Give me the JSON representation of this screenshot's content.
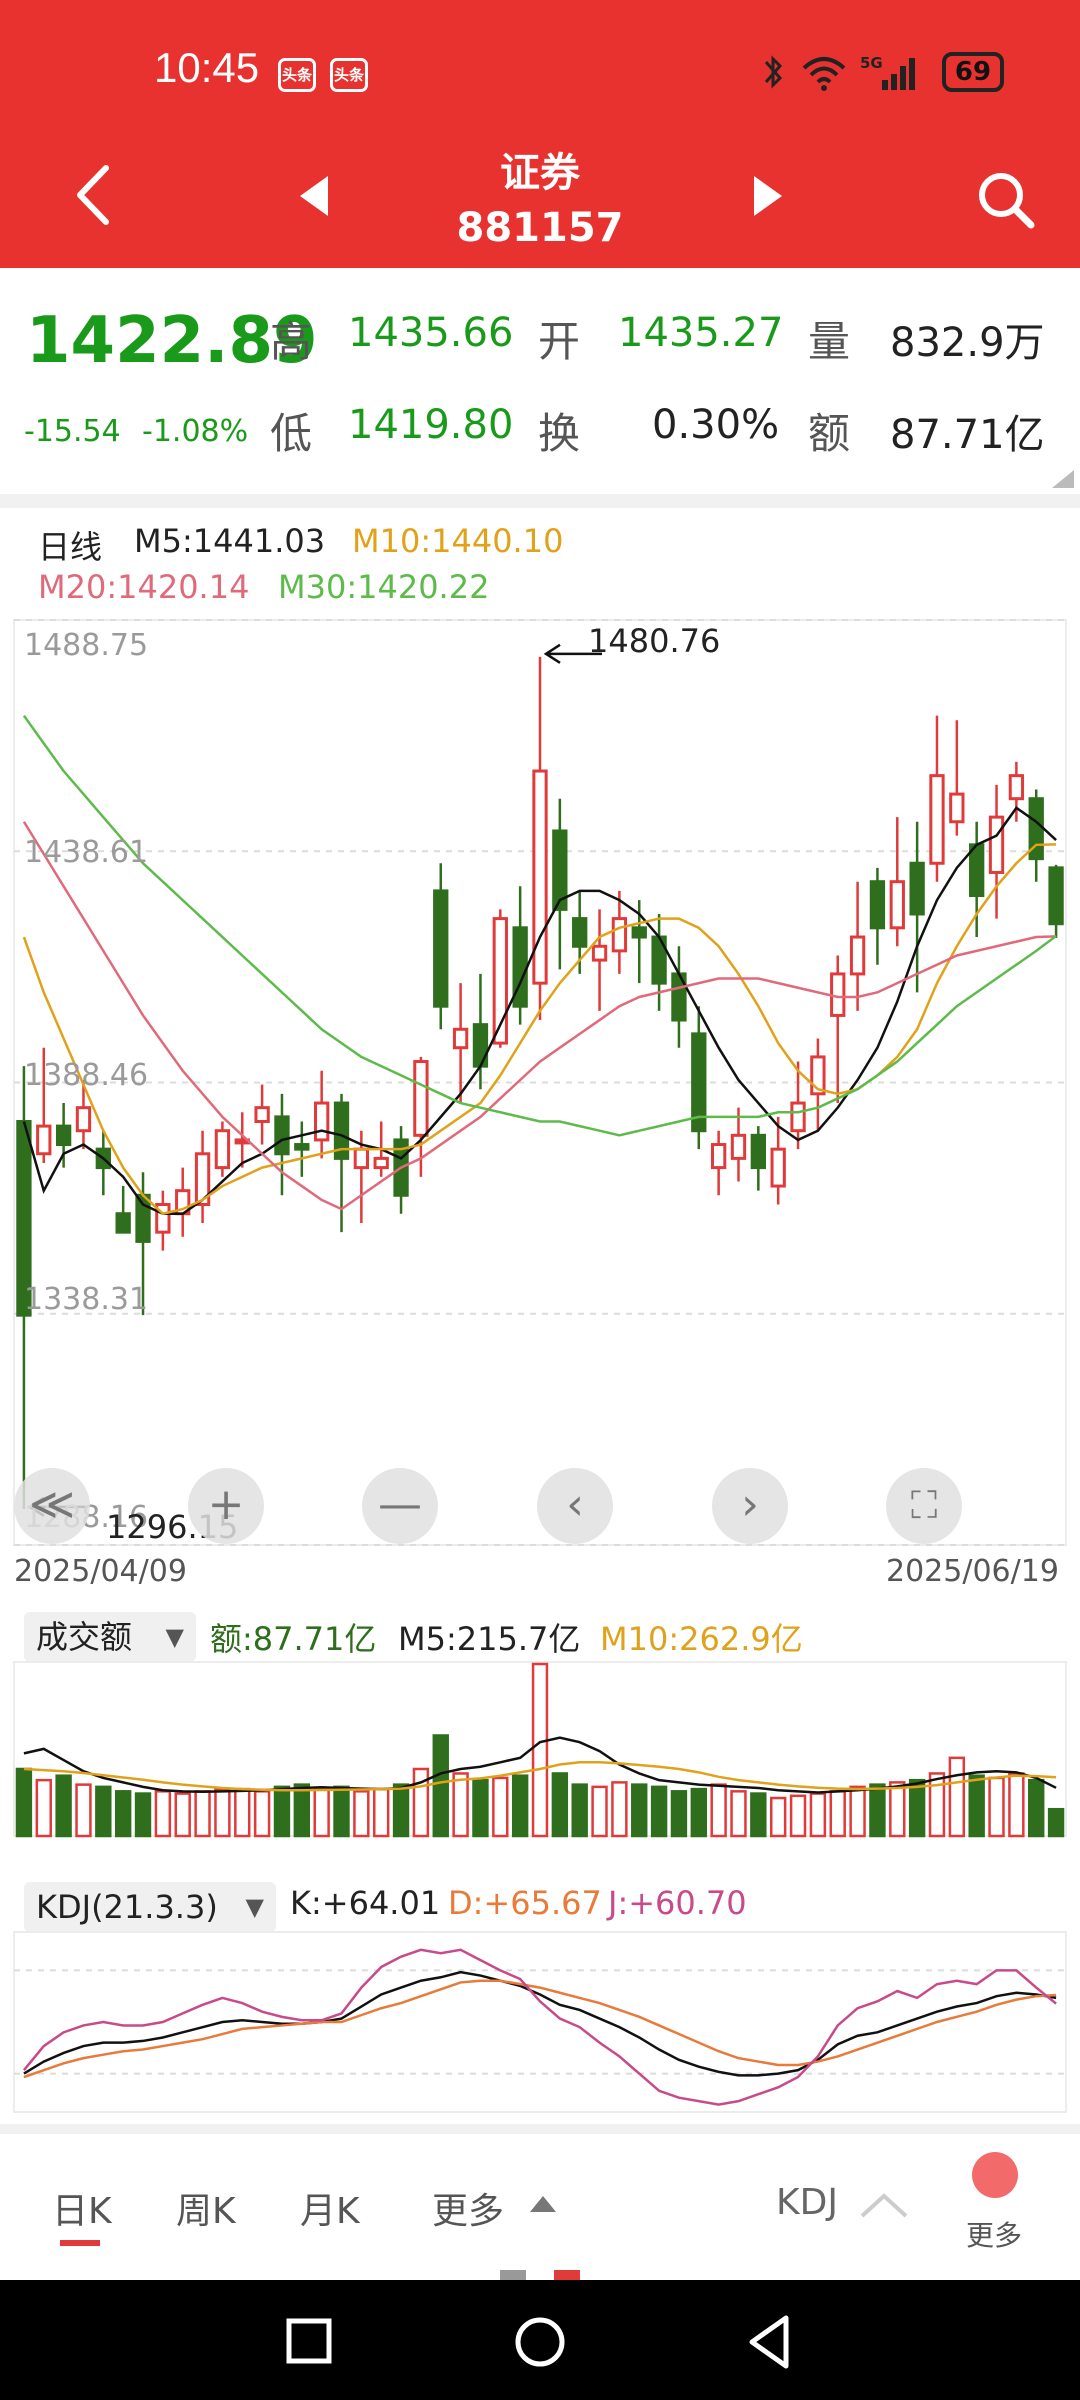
{
  "status_bar": {
    "time": "10:45",
    "app_icons": [
      "头条",
      "头条"
    ],
    "battery": "69"
  },
  "header": {
    "title": "证券",
    "code": "881157"
  },
  "quote": {
    "price": "1422.89",
    "change": "-15.54",
    "change_pct": "-1.08%",
    "high_label": "高",
    "high": "1435.66",
    "open_label": "开",
    "open": "1435.27",
    "volume_label": "量",
    "volume": "832.9万",
    "low_label": "低",
    "low": "1419.80",
    "turnover_label": "换",
    "turnover": "0.30%",
    "amount_label": "额",
    "amount": "87.71亿"
  },
  "ma_legend": {
    "period": "日线",
    "m5": "M5:1441.03",
    "m10": "M10:1440.10",
    "m20": "M20:1420.14",
    "m30": "M30:1420.22"
  },
  "colors": {
    "header_red": "#e8322f",
    "up": "#e03a3a",
    "down": "#2e6e1c",
    "m5": "#111111",
    "m10": "#e0a21a",
    "m20": "#e06a7a",
    "m30": "#5dbb4a",
    "kdj_d": "#e87a3a",
    "kdj_j": "#c84a8a"
  },
  "chart_data": [
    {
      "type": "candlestick",
      "title": "",
      "y_tick_labels": [
        "1488.75",
        "1438.61",
        "1388.46",
        "1338.31",
        "1288.16"
      ],
      "ylim": [
        1288.16,
        1488.75
      ],
      "max_annotation": "1480.76",
      "min_annotation": "1296.15",
      "date_start": "2025/04/09",
      "date_end": "2025/06/19",
      "candles": [
        [
          1380,
          1338,
          1392,
          1296
        ],
        [
          1373,
          1379,
          1396,
          1371
        ],
        [
          1379,
          1375,
          1384,
          1370
        ],
        [
          1378,
          1383,
          1389,
          1374
        ],
        [
          1374,
          1370,
          1378,
          1364
        ],
        [
          1360,
          1356,
          1366,
          1356
        ],
        [
          1364,
          1354,
          1369,
          1338
        ],
        [
          1356,
          1362,
          1365,
          1352
        ],
        [
          1360,
          1365,
          1370,
          1355
        ],
        [
          1362,
          1373,
          1378,
          1358
        ],
        [
          1370,
          1378,
          1380,
          1368
        ],
        [
          1376,
          1376,
          1382,
          1370
        ],
        [
          1380,
          1383,
          1388,
          1375
        ],
        [
          1381,
          1373,
          1386,
          1364
        ],
        [
          1375,
          1374,
          1380,
          1368
        ],
        [
          1376,
          1384,
          1391,
          1372
        ],
        [
          1384,
          1372,
          1386,
          1356
        ],
        [
          1370,
          1374,
          1378,
          1358
        ],
        [
          1370,
          1372,
          1380,
          1368
        ],
        [
          1376,
          1364,
          1379,
          1360
        ],
        [
          1377,
          1393,
          1394,
          1368
        ],
        [
          1430,
          1405,
          1436,
          1400
        ],
        [
          1396,
          1400,
          1410,
          1384
        ],
        [
          1401,
          1392,
          1412,
          1387
        ],
        [
          1397,
          1424,
          1426,
          1396
        ],
        [
          1422,
          1405,
          1431,
          1401
        ],
        [
          1410,
          1456,
          1480.76,
          1402
        ],
        [
          1443,
          1426,
          1450,
          1413
        ],
        [
          1424,
          1418,
          1430,
          1412
        ],
        [
          1415,
          1418,
          1426,
          1404
        ],
        [
          1417,
          1424,
          1430,
          1412
        ],
        [
          1422,
          1420,
          1428,
          1410
        ],
        [
          1420,
          1410,
          1425,
          1404
        ],
        [
          1412,
          1402,
          1418,
          1396
        ],
        [
          1399,
          1378,
          1405,
          1374
        ],
        [
          1370,
          1375,
          1378,
          1364
        ],
        [
          1372,
          1377,
          1383,
          1367
        ],
        [
          1377,
          1370,
          1379,
          1365
        ],
        [
          1366,
          1374,
          1381,
          1362
        ],
        [
          1378,
          1384,
          1393,
          1374
        ],
        [
          1386,
          1394,
          1398,
          1378
        ],
        [
          1403,
          1412,
          1416,
          1384
        ],
        [
          1412,
          1420,
          1432,
          1404
        ],
        [
          1432,
          1422,
          1435,
          1414
        ],
        [
          1422,
          1432,
          1446,
          1418
        ],
        [
          1436,
          1425,
          1445,
          1408
        ],
        [
          1436,
          1455,
          1468,
          1432
        ],
        [
          1445,
          1451,
          1467,
          1442
        ],
        [
          1440,
          1429,
          1445,
          1420
        ],
        [
          1434,
          1446,
          1453,
          1424
        ],
        [
          1450,
          1455,
          1458,
          1445
        ],
        [
          1450,
          1437,
          1452,
          1432
        ],
        [
          1435,
          1422.89,
          1435.66,
          1419.8
        ]
      ],
      "ma_series": [
        {
          "name": "M5",
          "values": [
            1380,
            1365,
            1373,
            1375,
            1372,
            1368,
            1362,
            1360,
            1360,
            1363,
            1367,
            1371,
            1373,
            1376,
            1377,
            1378,
            1377,
            1375,
            1374,
            1372,
            1376,
            1381,
            1386,
            1392,
            1401,
            1410,
            1420,
            1428,
            1430,
            1430,
            1428,
            1425,
            1420,
            1412,
            1404,
            1396,
            1389,
            1384,
            1379,
            1376,
            1378,
            1383,
            1389,
            1396,
            1406,
            1418,
            1428,
            1435,
            1440,
            1442,
            1448,
            1445,
            1441.03
          ]
        },
        {
          "name": "M10",
          "values": [
            1420,
            1408,
            1398,
            1388,
            1378,
            1370,
            1364,
            1360,
            1361,
            1363,
            1366,
            1368,
            1370,
            1371,
            1372,
            1373,
            1374,
            1374,
            1374,
            1374,
            1375,
            1378,
            1381,
            1384,
            1390,
            1397,
            1404,
            1410,
            1415,
            1420,
            1422,
            1423,
            1424,
            1424,
            1422,
            1418,
            1412,
            1405,
            1397,
            1391,
            1387,
            1386,
            1387,
            1390,
            1394,
            1400,
            1410,
            1418,
            1425,
            1431,
            1436,
            1440,
            1440.1
          ]
        },
        {
          "name": "M20",
          "values": [
            1445,
            1438,
            1431,
            1424,
            1417,
            1410,
            1403,
            1397,
            1391,
            1386,
            1381,
            1377,
            1373,
            1369,
            1366,
            1363,
            1361,
            1364,
            1367,
            1370,
            1372,
            1375,
            1378,
            1381,
            1385,
            1389,
            1393,
            1396,
            1399,
            1402,
            1405,
            1407,
            1408,
            1409,
            1410,
            1411,
            1411,
            1411,
            1410,
            1409,
            1408,
            1407,
            1407,
            1408,
            1410,
            1412,
            1414,
            1416,
            1417,
            1418,
            1419,
            1420,
            1420.14
          ]
        },
        {
          "name": "M30",
          "values": [
            1468,
            1462,
            1456,
            1451,
            1446,
            1441,
            1436,
            1432,
            1428,
            1424,
            1420,
            1416,
            1412,
            1408,
            1404,
            1400,
            1397,
            1394,
            1392,
            1390,
            1388,
            1386,
            1384,
            1383,
            1382,
            1381,
            1380,
            1380,
            1379,
            1378,
            1377,
            1378,
            1379,
            1380,
            1381,
            1381,
            1381,
            1381,
            1382,
            1382,
            1383,
            1385,
            1387,
            1390,
            1393,
            1397,
            1401,
            1405,
            1408,
            1411,
            1414,
            1417,
            1420.22
          ]
        }
      ]
    },
    {
      "type": "bar",
      "title": "成交额",
      "amount_label": "额:87.71亿",
      "m5_label": "M5:215.7亿",
      "m10_label": "M10:262.9亿",
      "values": [
        300,
        250,
        270,
        230,
        220,
        200,
        190,
        200,
        190,
        200,
        210,
        210,
        200,
        220,
        230,
        210,
        220,
        200,
        210,
        230,
        300,
        450,
        280,
        250,
        260,
        270,
        770,
        280,
        230,
        220,
        240,
        230,
        220,
        200,
        210,
        230,
        200,
        190,
        170,
        180,
        190,
        200,
        220,
        230,
        240,
        250,
        280,
        350,
        270,
        260,
        280,
        250,
        120
      ],
      "ma_series": [
        {
          "name": "M5",
          "values": [
            370,
            390,
            340,
            290,
            260,
            240,
            220,
            205,
            200,
            198,
            200,
            202,
            205,
            210,
            215,
            218,
            215,
            212,
            210,
            215,
            240,
            280,
            300,
            310,
            330,
            350,
            420,
            440,
            420,
            380,
            320,
            280,
            250,
            240,
            230,
            225,
            220,
            215,
            205,
            200,
            195,
            200,
            205,
            212,
            222,
            235,
            255,
            272,
            285,
            290,
            285,
            260,
            215.7
          ]
        },
        {
          "name": "M10",
          "values": [
            300,
            295,
            290,
            282,
            272,
            262,
            252,
            240,
            230,
            222,
            215,
            210,
            207,
            205,
            205,
            206,
            207,
            208,
            210,
            212,
            222,
            240,
            252,
            258,
            270,
            285,
            300,
            320,
            330,
            330,
            325,
            318,
            310,
            300,
            285,
            265,
            250,
            240,
            230,
            222,
            216,
            212,
            210,
            212,
            215,
            220,
            228,
            240,
            252,
            262,
            270,
            268,
            262.9
          ]
        }
      ]
    },
    {
      "type": "line",
      "title": "KDJ(21.3.3)",
      "k_label": "K:+64.01",
      "d_label": "D:+65.67",
      "j_label": "J:+60.70",
      "ylim": [
        0,
        100
      ],
      "series": [
        {
          "name": "K",
          "values": [
            20,
            27,
            32,
            36,
            38,
            38,
            39,
            41,
            44,
            47,
            50,
            51,
            50,
            49,
            49,
            50,
            52,
            59,
            66,
            70,
            74,
            76,
            79,
            77,
            74,
            71,
            66,
            60,
            57,
            52,
            47,
            41,
            34,
            28,
            24,
            21,
            19,
            19,
            20,
            22,
            28,
            37,
            42,
            44,
            48,
            52,
            56,
            59,
            61,
            65,
            67,
            66,
            64.01
          ]
        },
        {
          "name": "D",
          "values": [
            18,
            22,
            26,
            29,
            31,
            33,
            34,
            36,
            38,
            40,
            43,
            46,
            47,
            48,
            49,
            50,
            50,
            54,
            58,
            61,
            65,
            69,
            73,
            74,
            74,
            72,
            70,
            67,
            64,
            61,
            57,
            53,
            48,
            43,
            38,
            33,
            29,
            27,
            25,
            25,
            27,
            30,
            34,
            38,
            42,
            46,
            50,
            53,
            56,
            60,
            63,
            65,
            65.67
          ]
        },
        {
          "name": "J",
          "values": [
            22,
            36,
            44,
            48,
            50,
            48,
            48,
            50,
            55,
            60,
            64,
            61,
            56,
            53,
            51,
            51,
            55,
            70,
            82,
            88,
            92,
            90,
            92,
            86,
            80,
            75,
            62,
            52,
            47,
            38,
            30,
            20,
            10,
            6,
            4,
            2,
            4,
            8,
            12,
            18,
            30,
            48,
            58,
            62,
            68,
            64,
            72,
            74,
            72,
            80,
            80,
            70,
            60.7
          ]
        }
      ]
    }
  ],
  "chart_controls": [
    "≪",
    "+",
    "—",
    "‹",
    "›",
    "⛶"
  ],
  "bottom_nav": {
    "tabs": [
      "日K",
      "周K",
      "月K",
      "更多"
    ],
    "indicator": "KDJ",
    "more": "更多"
  }
}
